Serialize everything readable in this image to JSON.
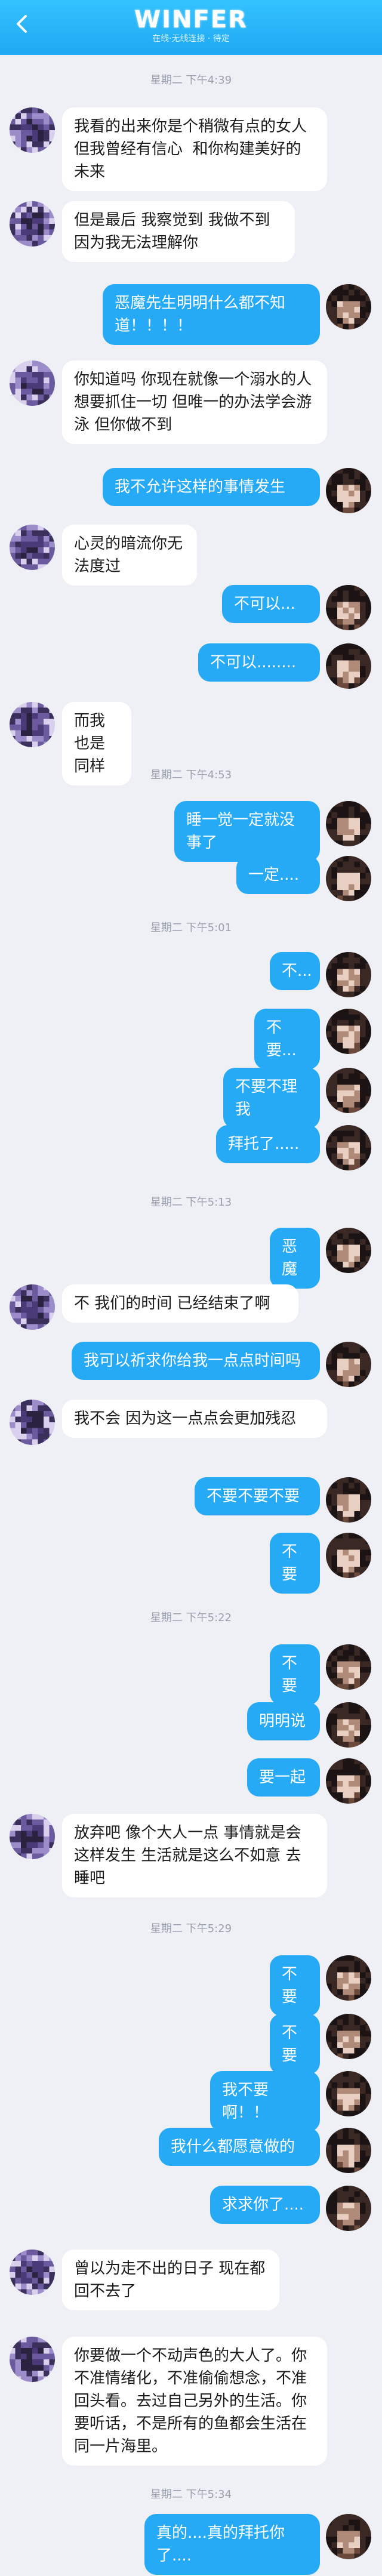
{
  "header": {
    "title": "WINFER",
    "subtitle": "在线·无线连接 · 待定"
  },
  "colors": {
    "accent": "#27aaf5",
    "header": "#1fa8f2",
    "background": "#eef0f6"
  },
  "timestamps": [
    "星期二 下午4:39",
    "星期二 下午4:53",
    "星期二 下午5:01",
    "星期二 下午5:13",
    "星期二 下午5:22",
    "星期二 下午5:29",
    "星期二 下午5:34"
  ],
  "messages": [
    {
      "side": "left",
      "text": "我看的出来你是个稍微有点的女人 但我曾经有信心  和你构建美好的未来"
    },
    {
      "side": "left",
      "text": "但是最后 我察觉到 我做不到 因为我无法理解你"
    },
    {
      "side": "right",
      "text": "恶魔先生明明什么都不知道！！！！"
    },
    {
      "side": "left",
      "text": "你知道吗 你现在就像一个溺水的人 想要抓住一切 但唯一的办法学会游泳 但你做不到"
    },
    {
      "side": "right",
      "text": "我不允许这样的事情发生"
    },
    {
      "side": "left",
      "text": "心灵的暗流你无法度过"
    },
    {
      "side": "right",
      "text": "不可以..."
    },
    {
      "side": "right",
      "text": "不可以........"
    },
    {
      "side": "left",
      "text": "而我也是同样"
    },
    {
      "side": "right",
      "text": "睡一觉一定就没事了"
    },
    {
      "side": "right",
      "text": "一定...."
    },
    {
      "side": "right",
      "text": "不..."
    },
    {
      "side": "right",
      "text": "不要..."
    },
    {
      "side": "right",
      "text": "不要不理我"
    },
    {
      "side": "right",
      "text": "拜托了....."
    },
    {
      "side": "right",
      "text": "恶魔"
    },
    {
      "side": "left",
      "text": "不 我们的时间 已经结束了啊"
    },
    {
      "side": "right",
      "text": "我可以祈求你给我一点点时间吗"
    },
    {
      "side": "left",
      "text": "我不会 因为这一点点会更加残忍"
    },
    {
      "side": "right",
      "text": "不要不要不要"
    },
    {
      "side": "right",
      "text": "不要"
    },
    {
      "side": "right",
      "text": "不要"
    },
    {
      "side": "right",
      "text": "明明说"
    },
    {
      "side": "right",
      "text": "要一起"
    },
    {
      "side": "left",
      "text": "放弃吧 像个大人一点 事情就是会这样发生 生活就是这么不如意 去睡吧"
    },
    {
      "side": "right",
      "text": "不要"
    },
    {
      "side": "right",
      "text": "不要"
    },
    {
      "side": "right",
      "text": "我不要啊！！"
    },
    {
      "side": "right",
      "text": "我什么都愿意做的"
    },
    {
      "side": "right",
      "text": "求求你了...."
    },
    {
      "side": "left",
      "text": "曾以为走不出的日子 现在都回不去了"
    },
    {
      "side": "left",
      "text": "你要做一个不动声色的大人了。你不准情绪化，不准偷偷想念，不准回头看。去过自己另外的生活。你要听话，不是所有的鱼都会生活在同一片海里。"
    },
    {
      "side": "right",
      "text": "真的....真的拜托你了...."
    }
  ]
}
